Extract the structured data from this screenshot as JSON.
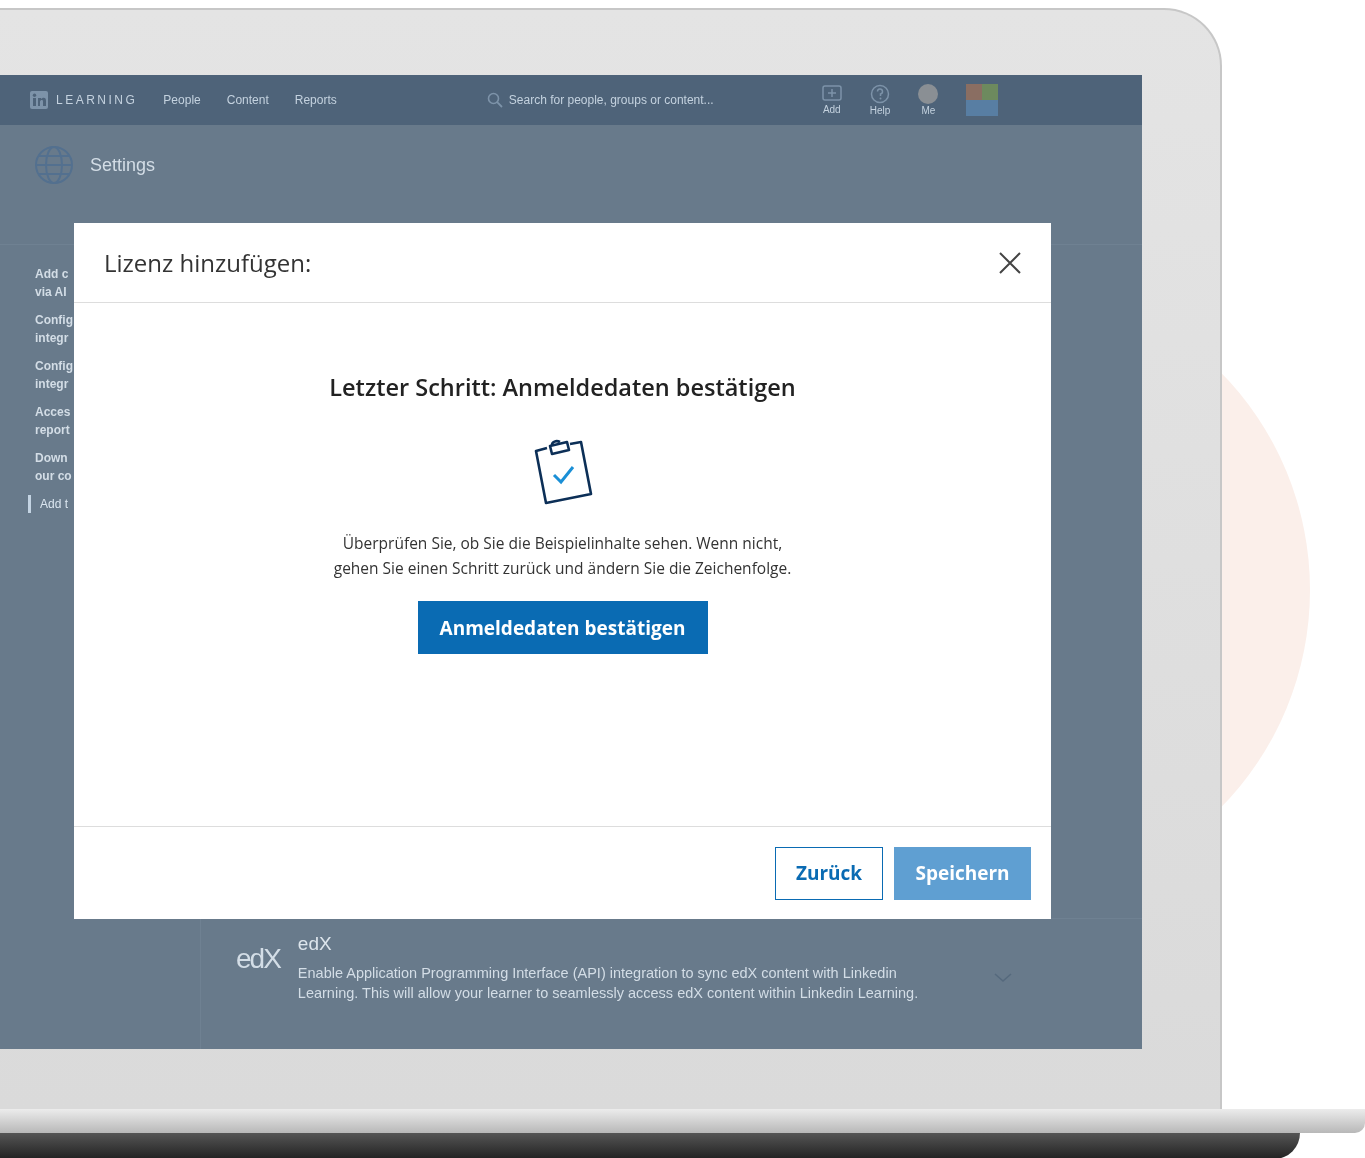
{
  "app": {
    "logo_text": "LEARNING",
    "nav": [
      "People",
      "Content",
      "Reports"
    ],
    "search": {
      "placeholder": "Search for people, groups or content..."
    },
    "actions": [
      {
        "kind": "add",
        "label": "Add"
      },
      {
        "kind": "help",
        "label": "Help"
      },
      {
        "kind": "me",
        "label": "Me"
      },
      {
        "kind": "apps"
      }
    ]
  },
  "page": {
    "title": "Settings",
    "sidebar": [
      {
        "lines": [
          "Add c",
          "via AI"
        ],
        "selected": false
      },
      {
        "lines": [
          "Config",
          "integr"
        ],
        "selected": false
      },
      {
        "lines": [
          "Config",
          "integr"
        ],
        "selected": false
      },
      {
        "lines": [
          "Acces",
          "report"
        ],
        "selected": false
      },
      {
        "lines": [
          "Down",
          "our co"
        ],
        "selected": false
      },
      {
        "lines": [
          "Add t"
        ],
        "selected": true
      }
    ],
    "integration": {
      "logo": "edX",
      "name": "edX",
      "description": "Enable Application Programming Interface (API) integration to sync edX content with Linkedin Learning. This will allow your learner to seamlessly access edX content within Linkedin Learning."
    }
  },
  "dialog": {
    "title": "Lizenz hinzufügen:",
    "heading": "Letzter Schritt: Anmeldedaten bestätigen",
    "message": "Überprüfen Sie, ob Sie die Beispielinhalte sehen. Wenn nicht, gehen Sie einen Schritt zurück und ändern Sie die Zeichenfolge.",
    "action": "Anmeldedaten bestätigen",
    "buttons": [
      {
        "label": "Zurück",
        "kind": "secondary",
        "disabled": false
      },
      {
        "label": "Speichern",
        "kind": "primary",
        "disabled": true
      }
    ]
  }
}
